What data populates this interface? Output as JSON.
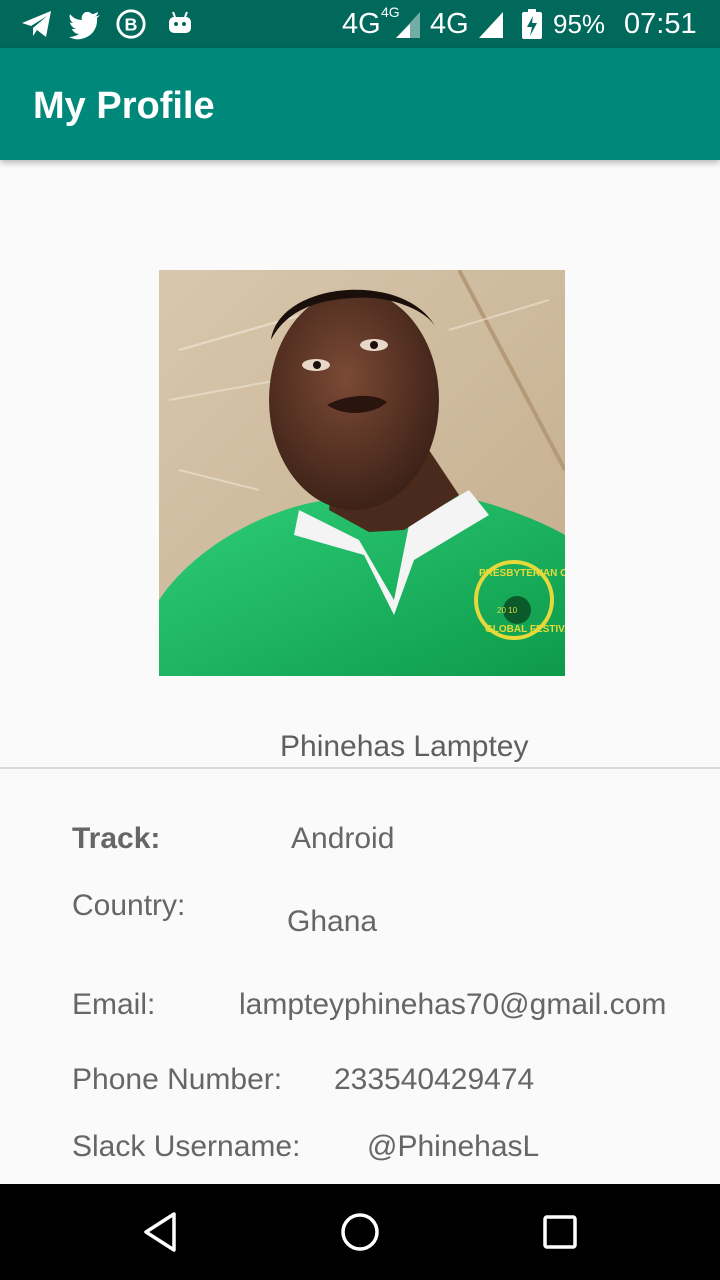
{
  "status_bar": {
    "icons": [
      "telegram-icon",
      "twitter-icon",
      "b-icon",
      "android-icon",
      "signal-icon",
      "battery-icon"
    ],
    "network_1": "4G",
    "network_1_sup": "4G",
    "network_2": "4G",
    "battery": "95%",
    "time": "07:51"
  },
  "app_bar": {
    "title": "My Profile"
  },
  "profile": {
    "name": "Phinehas Lamptey",
    "fields": [
      {
        "label": "Track:",
        "value": "Android"
      },
      {
        "label": "Country:",
        "value": "Ghana"
      },
      {
        "label": "Email:",
        "value": "lampteyphinehas70@gmail.com"
      },
      {
        "label": "Phone Number:",
        "value": "233540429474"
      },
      {
        "label": "Slack Username:",
        "value": "@PhinehasL"
      }
    ]
  },
  "photo": {
    "emblem_line1": "PRESBYTERIAN COLLEGE",
    "emblem_line2": "GLOBAL FESTIVAL",
    "emblem_year": "20  10"
  },
  "nav_bar": {
    "buttons": [
      "back-icon",
      "home-icon",
      "recents-icon"
    ]
  },
  "colors": {
    "status_bar": "#00695c",
    "app_bar": "#00897b",
    "background": "#fafafa",
    "text": "#666666"
  }
}
